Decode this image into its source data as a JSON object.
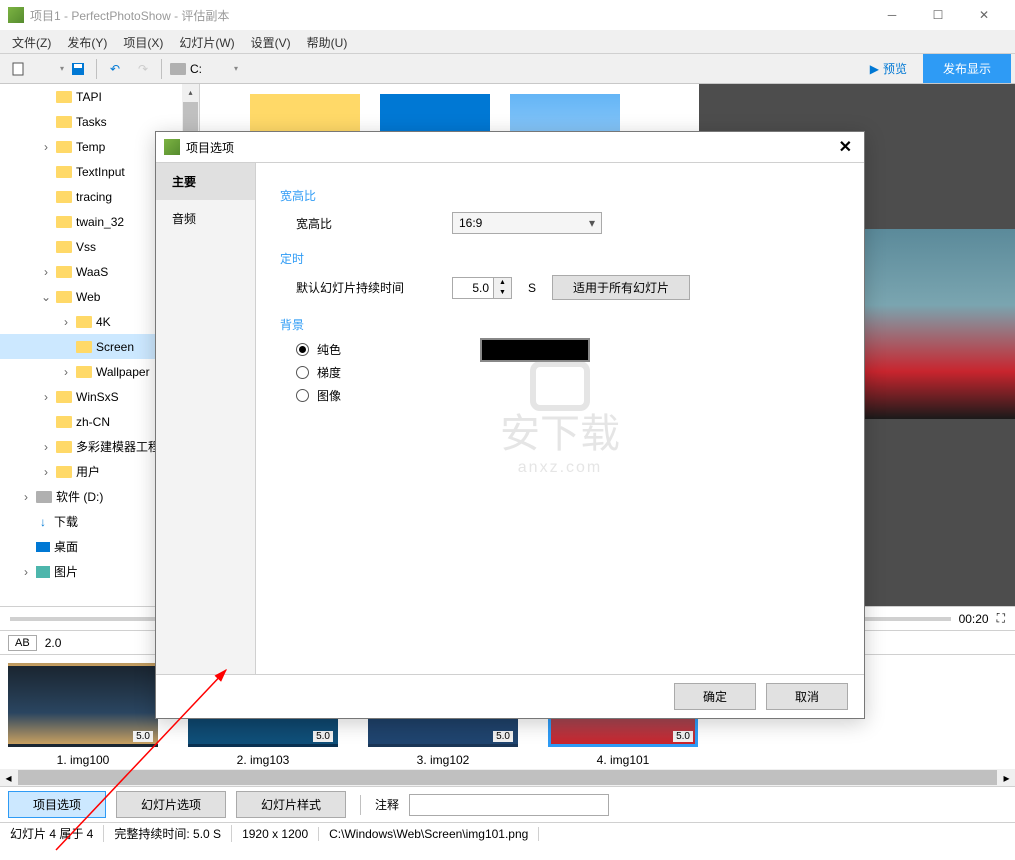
{
  "window": {
    "title": "项目1 - PerfectPhotoShow - 评估副本"
  },
  "menu": {
    "file": "文件(Z)",
    "publish": "发布(Y)",
    "project": "项目(X)",
    "slides": "幻灯片(W)",
    "settings": "设置(V)",
    "help": "帮助(U)"
  },
  "toolbar": {
    "drive": "C:",
    "preview": "预览",
    "publish_show": "发布显示"
  },
  "tree": {
    "items": [
      {
        "label": "TAPI",
        "indent": 40,
        "arrow": ""
      },
      {
        "label": "Tasks",
        "indent": 40,
        "arrow": ""
      },
      {
        "label": "Temp",
        "indent": 40,
        "arrow": "›"
      },
      {
        "label": "TextInput",
        "indent": 40,
        "arrow": ""
      },
      {
        "label": "tracing",
        "indent": 40,
        "arrow": ""
      },
      {
        "label": "twain_32",
        "indent": 40,
        "arrow": ""
      },
      {
        "label": "Vss",
        "indent": 40,
        "arrow": ""
      },
      {
        "label": "WaaS",
        "indent": 40,
        "arrow": "›"
      },
      {
        "label": "Web",
        "indent": 40,
        "arrow": "⌄"
      },
      {
        "label": "4K",
        "indent": 60,
        "arrow": "›"
      },
      {
        "label": "Screen",
        "indent": 60,
        "arrow": "",
        "selected": true
      },
      {
        "label": "Wallpaper",
        "indent": 60,
        "arrow": "›"
      },
      {
        "label": "WinSxS",
        "indent": 40,
        "arrow": "›"
      },
      {
        "label": "zh-CN",
        "indent": 40,
        "arrow": ""
      },
      {
        "label": "多彩建模器工程",
        "indent": 40,
        "arrow": "›"
      },
      {
        "label": "用户",
        "indent": 40,
        "arrow": "›"
      },
      {
        "label": "软件 (D:)",
        "indent": 20,
        "arrow": "›",
        "iconType": "drive"
      },
      {
        "label": "下载",
        "indent": 20,
        "arrow": "",
        "iconType": "download"
      },
      {
        "label": "桌面",
        "indent": 20,
        "arrow": "",
        "iconType": "desktop"
      },
      {
        "label": "图片",
        "indent": 20,
        "arrow": "›",
        "iconType": "picture"
      }
    ]
  },
  "timeline": {
    "time": "00:20"
  },
  "thumb_controls": {
    "ab": "AB",
    "zoom": "2.0"
  },
  "slides": [
    {
      "caption": "1. img100",
      "duration": "5.0"
    },
    {
      "caption": "2. img103",
      "duration": "5.0"
    },
    {
      "caption": "3. img102",
      "duration": "5.0"
    },
    {
      "caption": "4. img101",
      "duration": "5.0",
      "selected": true
    }
  ],
  "bottom": {
    "project_options": "项目选项",
    "slide_options": "幻灯片选项",
    "slide_styles": "幻灯片样式",
    "annotation": "注释"
  },
  "status": {
    "slide_count": "幻灯片 4 属于 4",
    "duration": "完整持续时间: 5.0 S",
    "resolution": "1920 x 1200",
    "path": "C:\\Windows\\Web\\Screen\\img101.png"
  },
  "dialog": {
    "title": "项目选项",
    "tabs": {
      "main": "主要",
      "audio": "音频"
    },
    "aspect_section": "宽高比",
    "aspect_label": "宽高比",
    "aspect_value": "16:9",
    "timing_section": "定时",
    "timing_label": "默认幻灯片持续时间",
    "timing_value": "5.0",
    "timing_unit": "S",
    "apply_all": "适用于所有幻灯片",
    "bg_section": "背景",
    "bg_solid": "纯色",
    "bg_gradient": "梯度",
    "bg_image": "图像",
    "ok": "确定",
    "cancel": "取消",
    "watermark": "安下载",
    "watermark_sub": "anxz.com"
  }
}
